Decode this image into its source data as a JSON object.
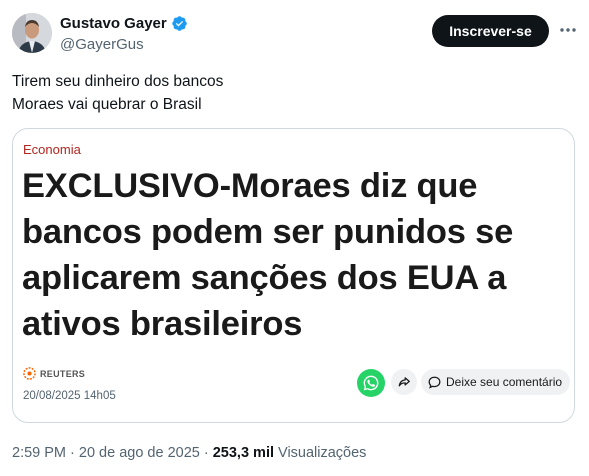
{
  "author": {
    "name": "Gustavo Gayer",
    "handle": "@GayerGus"
  },
  "follow_button_label": "Inscrever-se",
  "tweet_lines": [
    "Tirem seu dinheiro dos bancos",
    "Moraes vai quebrar o Brasil"
  ],
  "card": {
    "category": "Economia",
    "headline": "EXCLUSIVO-Moraes diz que bancos podem ser punidos se aplicarem sanções dos EUA a ativos brasileiros",
    "source": "REUTERS",
    "date": "20/08/2025 14h05",
    "comment_label": "Deixe seu comentário"
  },
  "meta": {
    "time": "2:59 PM",
    "separator": " · ",
    "date": "20 de ago de 2025",
    "views_count": "253,3 mil",
    "views_label": "Visualizações"
  },
  "colors": {
    "verified": "#1d9bf0",
    "follow_bg": "#0f1419",
    "category": "#b3261e",
    "reuters": "#fa6400",
    "whatsapp": "#25d366"
  }
}
